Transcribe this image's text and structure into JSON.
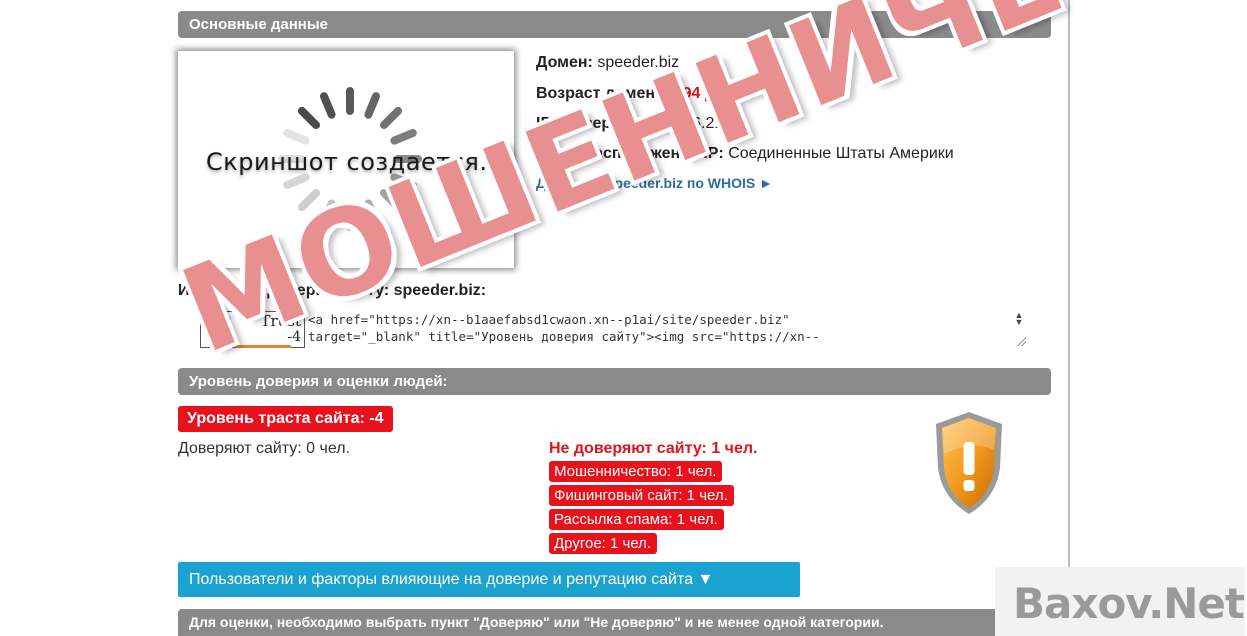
{
  "sections": {
    "main_title": "Основные данные",
    "trust_title": "Уровень доверия и оценки людей:"
  },
  "screenshot": {
    "caption": "Скриншот создается..."
  },
  "info": {
    "domain_label": "Домен:",
    "domain_value": "speeder.biz",
    "age_label": "Возраст домена:",
    "age_value": "294 дней.",
    "ip_label": "IP сервера:",
    "ip_value": "54.191.76.212",
    "geo_label": "Месторасположение IP:",
    "geo_value": "Соединенные Штаты Америки",
    "whois_link": "Данные о speeder.biz по WHOIS ►"
  },
  "informer": {
    "title": "Информер доверия сайту: speeder.biz:",
    "badge_label": "Trust",
    "badge_value": "-4",
    "code": "<a href=\"https://xn--b1aaefabsd1cwaon.xn--p1ai/site/speeder.biz\"\ntarget=\"_blank\" title=\"Уровень доверия сайту\"><img src=\"https://xn--"
  },
  "trust": {
    "level_text": "Уровень траста сайта: -4",
    "trust_count": "Доверяют сайту: 0 чел.",
    "distrust_title": "Не доверяют сайту: 1 чел.",
    "categories": [
      "Мошенничество: 1 чел.",
      "Фишинговый сайт: 1 чел.",
      "Рассылка спама: 1 чел.",
      "Другое: 1 чел."
    ]
  },
  "factors_button": "Пользователи и факторы влияющие на доверие и репутацию сайта ▼",
  "note": "Для оценки, необходимо выбрать пункт \"Доверяю\" или \"Не доверяю\" и не менее одной категории.",
  "stamp_text": "МОШЕННИЧЕСТВО",
  "watermark_text": "Baxov.Net",
  "colors": {
    "accent_red": "#e8121d",
    "button_blue": "#1aa3cf",
    "section_gray": "#8a8a8a",
    "link_blue": "#2d6e9f",
    "shield_orange": "#f39a1e"
  }
}
